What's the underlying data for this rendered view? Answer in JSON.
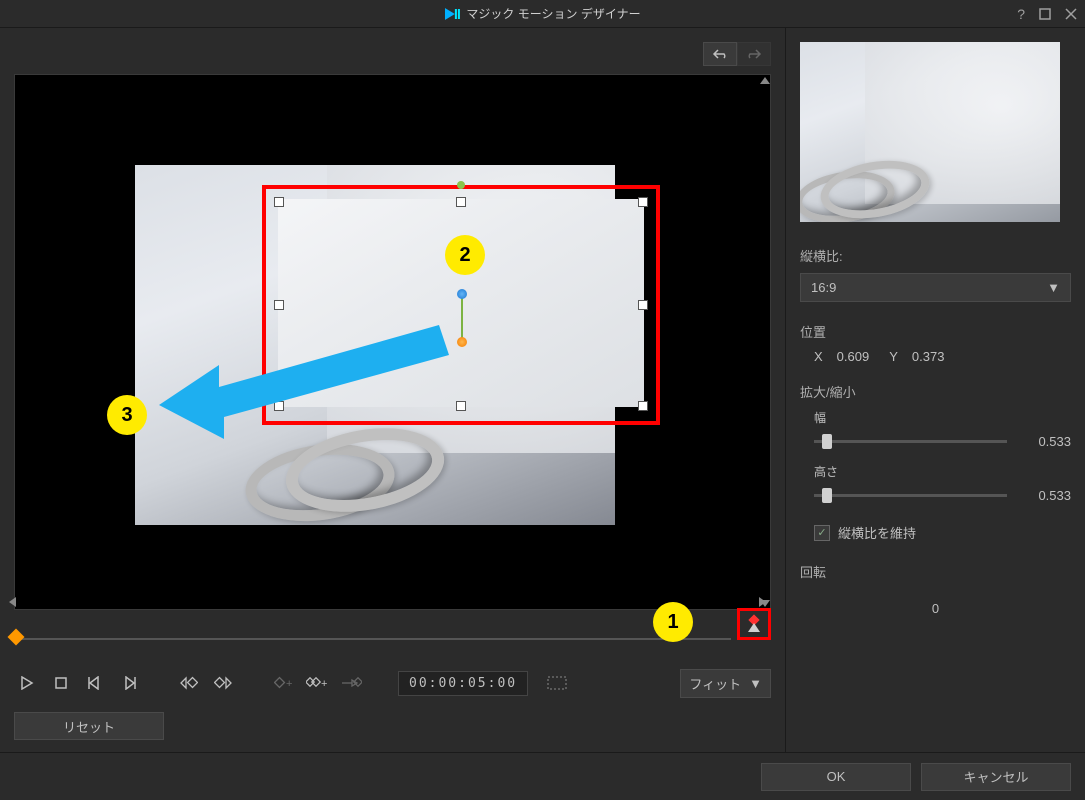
{
  "title": "マジック モーション デザイナー",
  "annotations": {
    "n1": "1",
    "n2": "2",
    "n3": "3"
  },
  "timecode": "00:00:05:00",
  "fit_label": "フィット",
  "reset_label": "リセット",
  "right": {
    "aspect_label": "縦横比:",
    "aspect_value": "16:9",
    "position_label": "位置",
    "x_label": "X",
    "x_value": "0.609",
    "y_label": "Y",
    "y_value": "0.373",
    "scale_label": "拡大/縮小",
    "width_label": "幅",
    "width_value": "0.533",
    "height_label": "高さ",
    "height_value": "0.533",
    "keep_aspect": "縦横比を維持",
    "rotation_label": "回転",
    "rotation_value": "0"
  },
  "footer": {
    "ok": "OK",
    "cancel": "キャンセル"
  }
}
